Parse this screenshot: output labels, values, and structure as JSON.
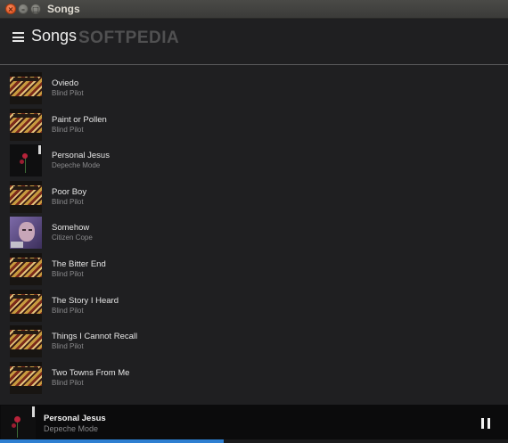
{
  "window": {
    "title": "Songs"
  },
  "header": {
    "title": "Songs",
    "watermark": "SOFTPEDIA"
  },
  "songs": [
    {
      "title": "Oviedo",
      "artist": "Blind Pilot",
      "art": "blind"
    },
    {
      "title": "Paint or Pollen",
      "artist": "Blind Pilot",
      "art": "blind"
    },
    {
      "title": "Personal Jesus",
      "artist": "Depeche Mode",
      "art": "depeche"
    },
    {
      "title": "Poor Boy",
      "artist": "Blind Pilot",
      "art": "blind"
    },
    {
      "title": "Somehow",
      "artist": "Citizen Cope",
      "art": "citizen"
    },
    {
      "title": "The Bitter End",
      "artist": "Blind Pilot",
      "art": "blind"
    },
    {
      "title": "The Story I Heard",
      "artist": "Blind Pilot",
      "art": "blind"
    },
    {
      "title": "Things I Cannot Recall",
      "artist": "Blind Pilot",
      "art": "blind"
    },
    {
      "title": "Two Towns From Me",
      "artist": "Blind Pilot",
      "art": "blind"
    }
  ],
  "now_playing": {
    "title": "Personal Jesus",
    "artist": "Depeche Mode",
    "progress": 0.44,
    "state": "playing"
  },
  "colors": {
    "background": "#1f1f21",
    "accent": "#2e7fd1",
    "close_button": "#df4b16"
  },
  "icons": {
    "menu": "hamburger-icon",
    "pause": "pause-icon"
  }
}
